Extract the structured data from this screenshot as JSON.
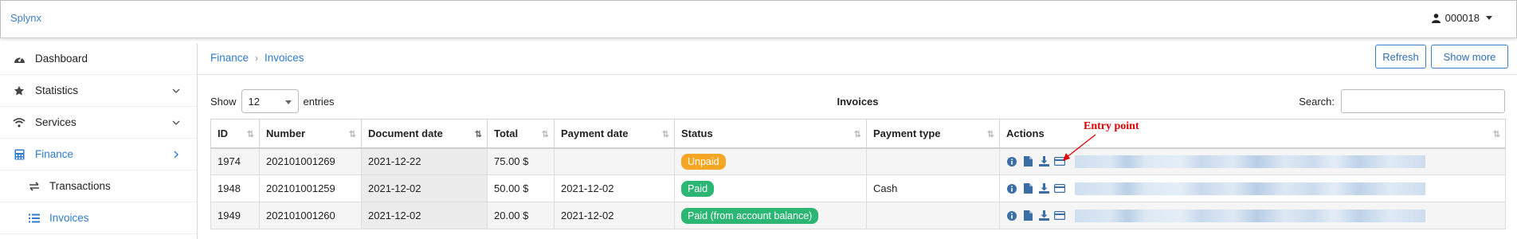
{
  "app": {
    "brand": "Splynx",
    "user": "000018"
  },
  "sidebar": {
    "items": [
      {
        "label": "Dashboard",
        "icon": "dashboard-icon"
      },
      {
        "label": "Statistics",
        "icon": "star-icon"
      },
      {
        "label": "Services",
        "icon": "wifi-icon"
      },
      {
        "label": "Finance",
        "icon": "calculator-icon"
      }
    ],
    "sub": [
      {
        "label": "Transactions",
        "icon": "arrows-icon"
      },
      {
        "label": "Invoices",
        "icon": "list-icon"
      }
    ]
  },
  "breadcrumb": {
    "root": "Finance",
    "current": "Invoices"
  },
  "toolbar": {
    "refresh": "Refresh",
    "show_more": "Show more"
  },
  "table_tools": {
    "show": "Show",
    "entries_value": "12",
    "entries": "entries",
    "title": "Invoices",
    "search": "Search:"
  },
  "table": {
    "headers": [
      "ID",
      "Number",
      "Document date",
      "Total",
      "Payment date",
      "Status",
      "Payment type",
      "Actions"
    ],
    "rows": [
      {
        "id": "1974",
        "number": "202101001269",
        "doc_date": "2021-12-22",
        "total": "75.00 $",
        "pay_date": "",
        "status": "Unpaid",
        "status_color": "#f5a623",
        "pay_type": ""
      },
      {
        "id": "1948",
        "number": "202101001259",
        "doc_date": "2021-12-02",
        "total": "50.00 $",
        "pay_date": "2021-12-02",
        "status": "Paid",
        "status_color": "#2bb673",
        "pay_type": "Cash"
      },
      {
        "id": "1949",
        "number": "202101001260",
        "doc_date": "2021-12-02",
        "total": "20.00 $",
        "pay_date": "2021-12-02",
        "status": "Paid (from account balance)",
        "status_color": "#2bb673",
        "pay_type": ""
      }
    ]
  },
  "annotation": {
    "label": "Entry point",
    "color": "#e00000"
  },
  "colors": {
    "accent": "#2f7bcf",
    "unpaid": "#f5a623",
    "paid": "#2bb673"
  }
}
